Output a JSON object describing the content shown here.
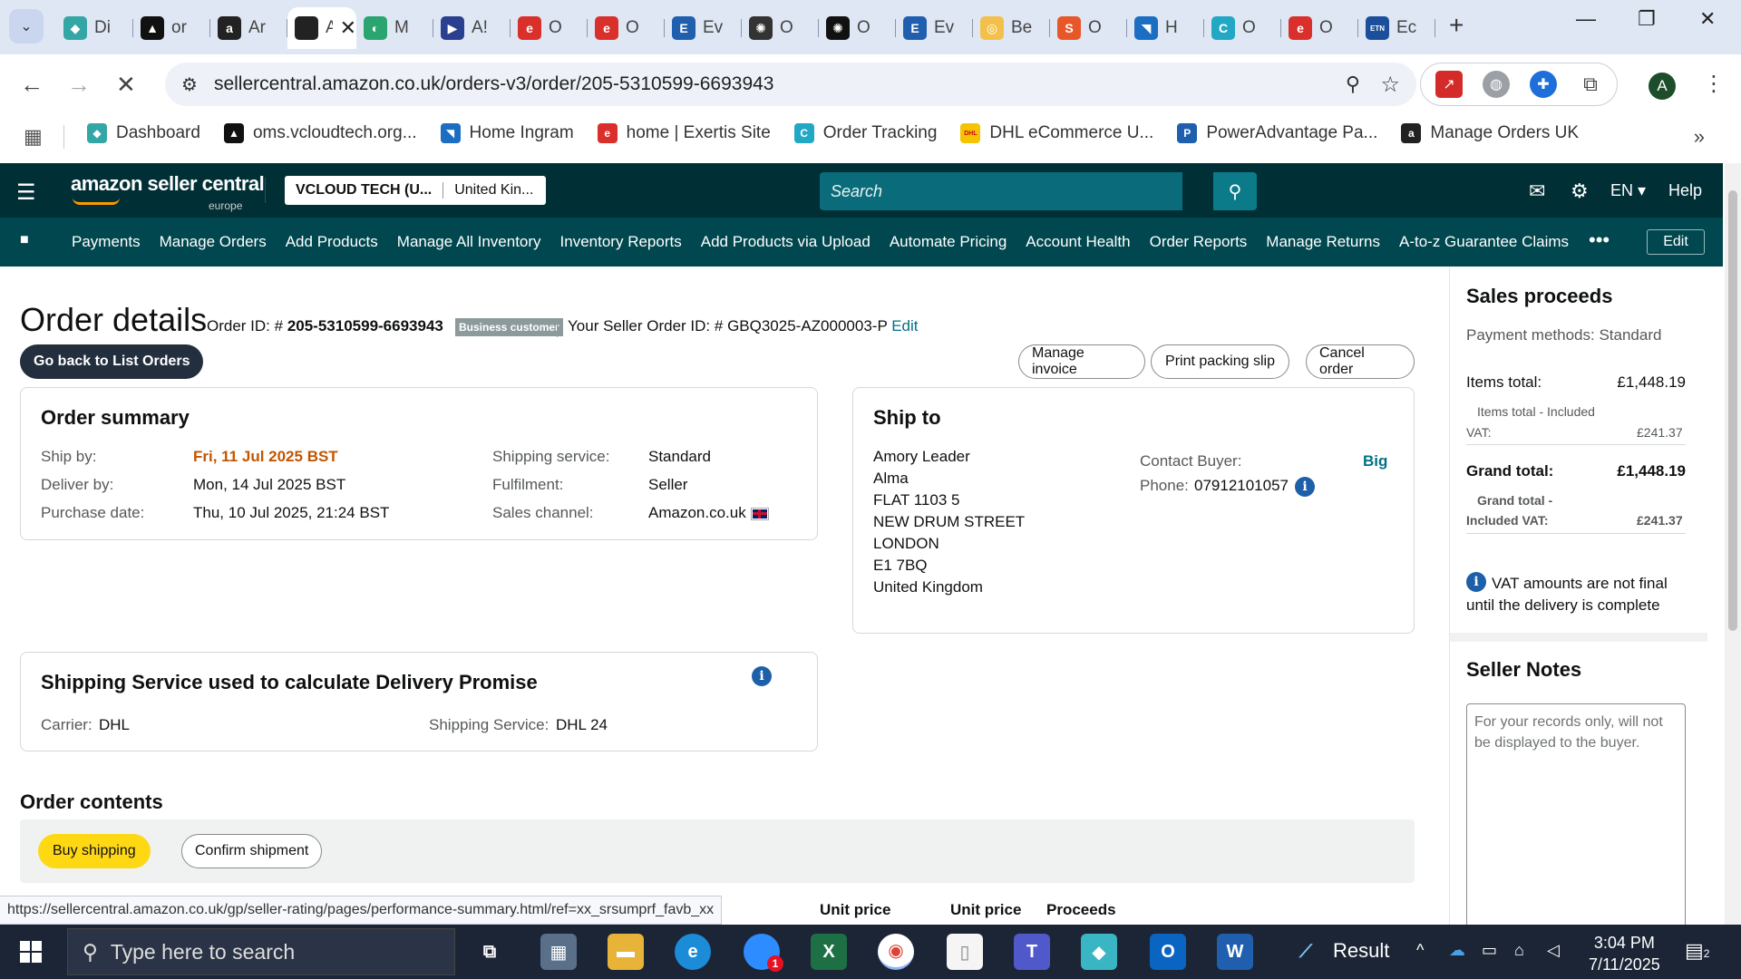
{
  "browser": {
    "tabs": [
      {
        "title": "Di",
        "icon_color": "#35a6a6",
        "glyph": "◆"
      },
      {
        "title": "or",
        "icon_color": "#111111",
        "glyph": "▲"
      },
      {
        "title": "Ar",
        "icon_color": "#222222",
        "glyph": "a"
      },
      {
        "title": "Ar",
        "icon_color": "#ffffff",
        "glyph": "",
        "active": true
      },
      {
        "title": "M",
        "icon_color": "#2aa56f",
        "glyph": "◐"
      },
      {
        "title": "A!",
        "icon_color": "#2a3f8f",
        "glyph": "▶"
      },
      {
        "title": "O",
        "icon_color": "#d9302c",
        "glyph": "e"
      },
      {
        "title": "O",
        "icon_color": "#d9302c",
        "glyph": "e"
      },
      {
        "title": "Ev",
        "icon_color": "#1f5fae",
        "glyph": "E"
      },
      {
        "title": "O",
        "icon_color": "#333333",
        "glyph": "✺"
      },
      {
        "title": "O",
        "icon_color": "#111111",
        "glyph": "✺"
      },
      {
        "title": "Ev",
        "icon_color": "#1f5fae",
        "glyph": "E"
      },
      {
        "title": "Be",
        "icon_color": "#f3c14b",
        "glyph": "◎"
      },
      {
        "title": "O",
        "icon_color": "#e8572a",
        "glyph": "S"
      },
      {
        "title": "H",
        "icon_color": "#1b6ec2",
        "glyph": "◥"
      },
      {
        "title": "O",
        "icon_color": "#22a8c4",
        "glyph": "C"
      },
      {
        "title": "O",
        "icon_color": "#d9302c",
        "glyph": "e"
      },
      {
        "title": "Ec",
        "icon_color": "#1b4f9c",
        "glyph": "ETN"
      }
    ],
    "url": "sellercentral.amazon.co.uk/orders-v3/order/205-5310599-6693943",
    "profile_initial": "A",
    "bookmarks": [
      {
        "label": "Dashboard",
        "icon_color": "#35a6a6",
        "glyph": "◆"
      },
      {
        "label": "oms.vcloudtech.org...",
        "icon_color": "#111111",
        "glyph": "▲"
      },
      {
        "label": "Home Ingram",
        "icon_color": "#1b6ec2",
        "glyph": "◥"
      },
      {
        "label": "home | Exertis Site",
        "icon_color": "#d9302c",
        "glyph": "e"
      },
      {
        "label": "Order Tracking",
        "icon_color": "#22a8c4",
        "glyph": "C"
      },
      {
        "label": "DHL eCommerce U...",
        "icon_color": "#f5c400",
        "glyph": "DHL"
      },
      {
        "label": "PowerAdvantage Pa...",
        "icon_color": "#1f5fae",
        "glyph": "P"
      },
      {
        "label": "Manage Orders UK",
        "icon_color": "#222222",
        "glyph": "a"
      }
    ]
  },
  "header": {
    "logo_text": "amazon seller central",
    "logo_sub": "europe",
    "account_name": "VCLOUD TECH (U...",
    "marketplace": "United Kin...",
    "search_placeholder": "Search",
    "language": "EN",
    "help": "Help"
  },
  "nav": {
    "items": [
      "Payments",
      "Manage Orders",
      "Add Products",
      "Manage All Inventory",
      "Inventory Reports",
      "Add Products via Upload",
      "Automate Pricing",
      "Account Health",
      "Order Reports",
      "Manage Returns",
      "A-to-z Guarantee Claims"
    ],
    "more": "•••",
    "edit": "Edit"
  },
  "page": {
    "title": "Order details",
    "order_id_label": "Order ID: # ",
    "order_id": "205-5310599-6693943",
    "business_badge": "Business customer",
    "seller_order_id_label": "Your Seller Order ID: # ",
    "seller_order_id": "GBQ3025-AZ000003-P",
    "edit_link": "Edit",
    "back_button": "Go back to List Orders",
    "actions": [
      "Manage invoice",
      "Print packing slip",
      "Cancel order"
    ]
  },
  "order_summary": {
    "title": "Order summary",
    "ship_by_label": "Ship by:",
    "ship_by": "Fri, 11 Jul 2025 BST",
    "deliver_by_label": "Deliver by:",
    "deliver_by": "Mon, 14 Jul 2025 BST",
    "purchase_date_label": "Purchase date:",
    "purchase_date": "Thu, 10 Jul 2025, 21:24 BST",
    "shipping_service_label": "Shipping service:",
    "shipping_service": "Standard",
    "fulfilment_label": "Fulfilment:",
    "fulfilment": "Seller",
    "sales_channel_label": "Sales channel:",
    "sales_channel": "Amazon.co.uk"
  },
  "ship_to": {
    "title": "Ship to",
    "address": [
      "Amory Leader",
      "Alma",
      "FLAT 1103 5",
      "NEW DRUM STREET",
      "LONDON",
      "E1 7BQ",
      "United Kingdom"
    ],
    "contact_buyer_label": "Contact Buyer:",
    "contact_buyer": "Big",
    "phone_label": "Phone:",
    "phone": "07912101057"
  },
  "delivery_promise": {
    "title": "Shipping Service used to calculate Delivery Promise",
    "carrier_label": "Carrier:",
    "carrier": "DHL",
    "service_label": "Shipping Service:",
    "service": "DHL 24"
  },
  "order_contents": {
    "title": "Order contents",
    "buy_shipping": "Buy shipping",
    "confirm_shipment": "Confirm shipment",
    "columns": [
      "Unit price",
      "Unit price",
      "Proceeds"
    ]
  },
  "sales_proceeds": {
    "title": "Sales proceeds",
    "payment_methods": "Payment methods: Standard",
    "items_total_label": "Items total:",
    "items_total": "£1,448.19",
    "items_vat_label_1": "Items total - Included",
    "items_vat_label_2": "VAT:",
    "items_vat": "£241.37",
    "grand_total_label": "Grand total:",
    "grand_total": "£1,448.19",
    "grand_vat_label_1": "Grand total -",
    "grand_vat_label_2": "Included VAT:",
    "grand_vat": "£241.37",
    "vat_note": "VAT amounts are not final until the delivery is complete"
  },
  "seller_notes": {
    "title": "Seller Notes",
    "placeholder": "For your records only, will not be displayed to the buyer."
  },
  "status_bar_url": "https://sellercentral.amazon.co.uk/gp/seller-rating/pages/performance-summary.html/ref=xx_srsumprf_favb_xx",
  "taskbar": {
    "search_placeholder": "Type here to search",
    "weather_label": "Result",
    "time": "3:04 PM",
    "date": "7/11/2025",
    "notification_count": "2",
    "zoom_badge": "1"
  }
}
